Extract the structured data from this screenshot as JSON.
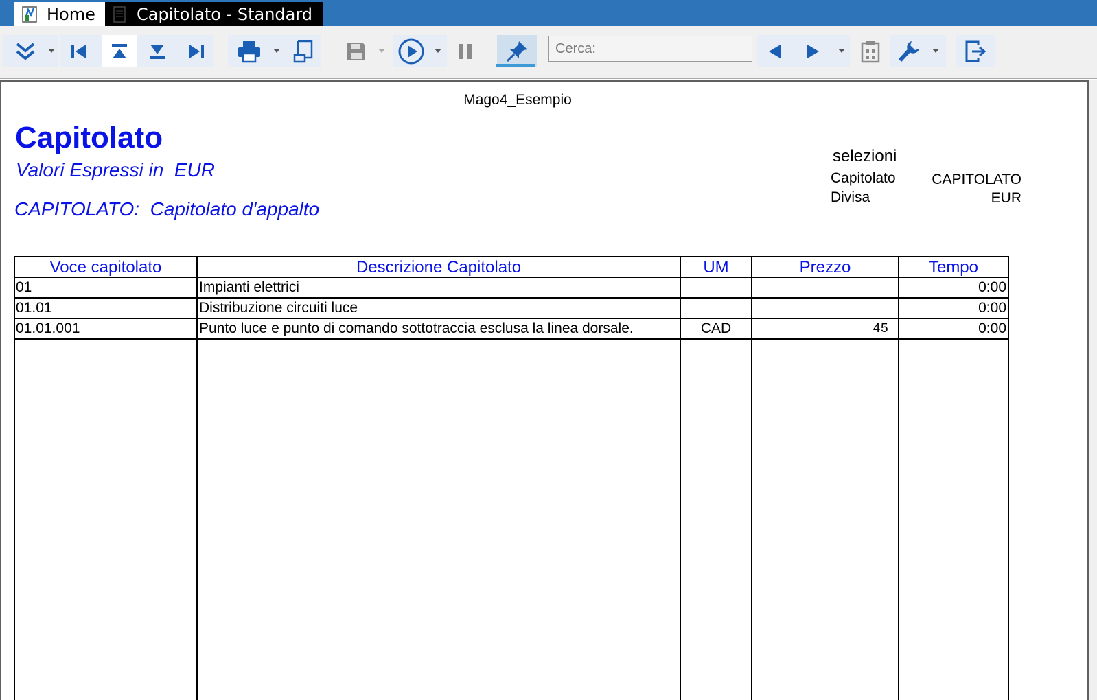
{
  "tabs": {
    "home_label": "Home",
    "document_label": "Capitolato - Standard"
  },
  "toolbar": {
    "search_placeholder": "Cerca:",
    "icons": [
      "expand-all-icon",
      "first-record-icon",
      "previous-page-icon",
      "next-page-icon",
      "last-record-icon",
      "print-icon",
      "print-preview-icon",
      "save-icon",
      "run-icon",
      "pause-icon",
      "pin-icon",
      "search-prev-icon",
      "search-next-icon",
      "clipboard-icon",
      "tools-icon",
      "exit-icon"
    ],
    "accent_color": "#2e74b8"
  },
  "report": {
    "company": "Mago4_Esempio",
    "title": "Capitolato",
    "subtitle": "Valori Espressi in  EUR",
    "capitolato_line": "CAPITOLATO:  Capitolato d'appalto",
    "selections": {
      "title": "selezioni",
      "rows": [
        {
          "label": "Capitolato",
          "value": "CAPITOLATO"
        },
        {
          "label": "Divisa",
          "value": "EUR"
        }
      ]
    },
    "text_color": "#0a13e6"
  },
  "table": {
    "headers": [
      "Voce capitolato",
      "Descrizione Capitolato",
      "UM",
      "Prezzo",
      "Tempo"
    ],
    "rows": [
      {
        "voce": "01",
        "descrizione": "Impianti elettrici",
        "um": "",
        "prezzo": "",
        "tempo": "0:00"
      },
      {
        "voce": "01.01",
        "descrizione": "Distribuzione circuiti luce",
        "um": "",
        "prezzo": "",
        "tempo": "0:00"
      },
      {
        "voce": "01.01.001",
        "descrizione": "Punto luce e punto di comando sottotraccia esclusa la linea dorsale.",
        "um": "CAD",
        "prezzo": "45",
        "tempo": "0:00"
      }
    ]
  }
}
